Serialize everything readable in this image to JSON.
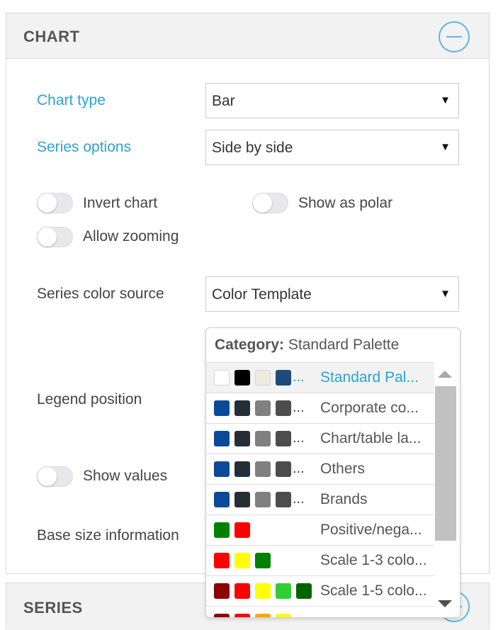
{
  "chart_panel": {
    "title": "CHART",
    "chart_type": {
      "label": "Chart type",
      "value": "Bar"
    },
    "series_options": {
      "label": "Series options",
      "value": "Side by side"
    },
    "toggles": {
      "invert_chart": {
        "label": "Invert chart",
        "on": false
      },
      "show_as_polar": {
        "label": "Show as polar",
        "on": false
      },
      "allow_zooming": {
        "label": "Allow zooming",
        "on": false
      },
      "show_values": {
        "label": "Show values",
        "on": false
      }
    },
    "series_color_source": {
      "label": "Series color source",
      "value": "Color Template"
    },
    "legend_position": {
      "label": "Legend position"
    },
    "base_size_information": {
      "label": "Base size information"
    }
  },
  "dropdown": {
    "category_label": "Category:",
    "category_value": "Standard Palette",
    "items": [
      {
        "name": "Standard Pal...",
        "selected": true,
        "ellipsis": "...",
        "colors": [
          "#ffffff",
          "#000000",
          "#eeeae0",
          "#1f4a7c"
        ]
      },
      {
        "name": "Corporate co...",
        "selected": false,
        "ellipsis": "...",
        "colors": [
          "#0b4a99",
          "#262e35",
          "#808080",
          "#4d4d4d"
        ]
      },
      {
        "name": "Chart/table la...",
        "selected": false,
        "ellipsis": "...",
        "colors": [
          "#0b4a99",
          "#262e35",
          "#808080",
          "#4d4d4d"
        ]
      },
      {
        "name": "Others",
        "selected": false,
        "ellipsis": "...",
        "colors": [
          "#0b4a99",
          "#262e35",
          "#808080",
          "#4d4d4d"
        ]
      },
      {
        "name": "Brands",
        "selected": false,
        "ellipsis": "...",
        "colors": [
          "#0b4a99",
          "#262e35",
          "#808080",
          "#4d4d4d"
        ]
      },
      {
        "name": "Positive/nega...",
        "selected": false,
        "ellipsis": "",
        "colors": [
          "#008000",
          "#ff0000"
        ]
      },
      {
        "name": "Scale 1-3 colo...",
        "selected": false,
        "ellipsis": "",
        "colors": [
          "#ff0000",
          "#ffff00",
          "#008000"
        ]
      },
      {
        "name": "Scale 1-5 colo...",
        "selected": false,
        "ellipsis": "",
        "colors": [
          "#8b0000",
          "#ff0000",
          "#ffff00",
          "#32cd32",
          "#006400"
        ]
      },
      {
        "name": "",
        "selected": false,
        "ellipsis": "",
        "colors": [
          "#8b0000",
          "#ff0000",
          "#ffa500",
          "#ffff00"
        ]
      }
    ]
  },
  "series_panel": {
    "title": "SERIES"
  },
  "colors": {
    "accent": "#2aa3d2",
    "collapse_icon": "#5bb7e4"
  }
}
